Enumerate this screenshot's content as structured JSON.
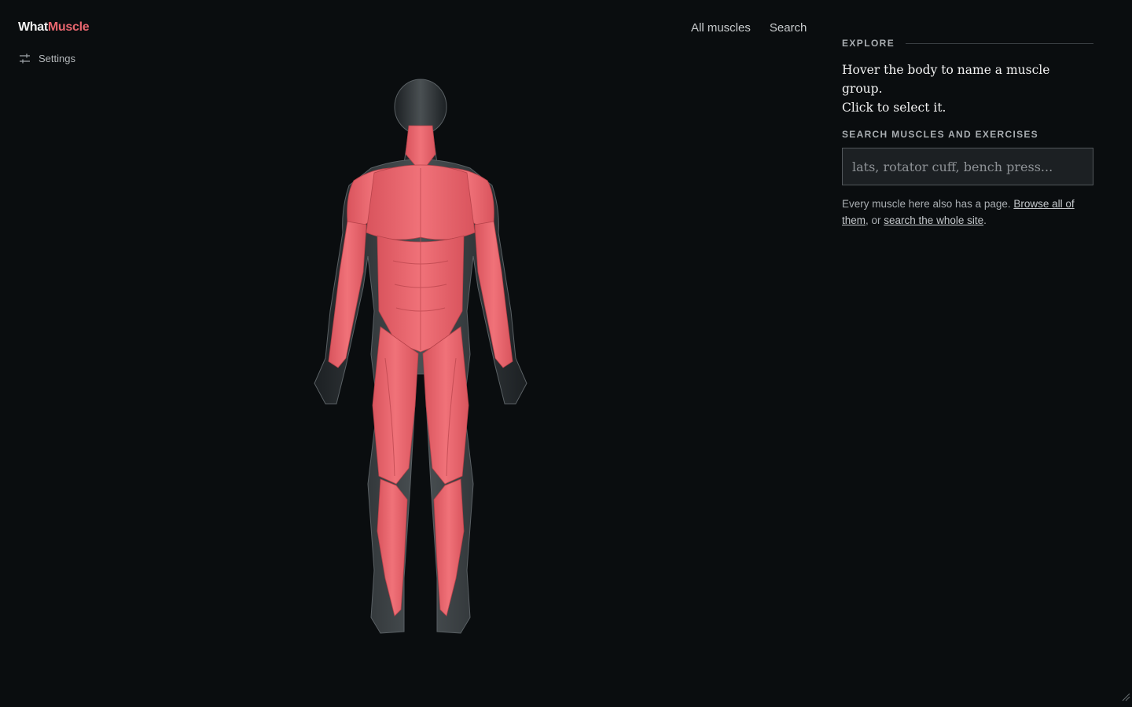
{
  "brand": {
    "part1": "What",
    "part2": "Muscle",
    "accent": "#e8666e"
  },
  "settings": {
    "label": "Settings",
    "icon": "sliders-icon"
  },
  "nav": {
    "all_muscles": "All muscles",
    "search": "Search"
  },
  "panel": {
    "eyebrow": "EXPLORE",
    "intro_line1": "Hover the body to name a muscle group.",
    "intro_line2": "Click to select it.",
    "search_label": "SEARCH MUSCLES AND EXERCISES",
    "search_placeholder": "lats, rotator cuff, bench press...",
    "note_prefix": "Every muscle here also has a page. ",
    "browse_link": "Browse all of them",
    "note_middle": ", or ",
    "site_link": "search the whole site",
    "note_suffix": "."
  },
  "figure": {
    "muscle_color": "#e8666e",
    "body_color": "#3a3f42"
  }
}
